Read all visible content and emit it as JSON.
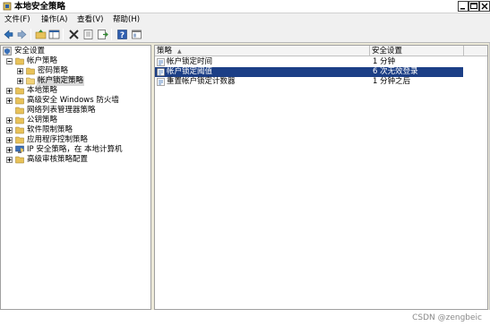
{
  "window": {
    "title": "本地安全策略"
  },
  "menu": [
    {
      "label": "文件(F)"
    },
    {
      "label": "操作(A)"
    },
    {
      "label": "查看(V)"
    },
    {
      "label": "帮助(H)"
    }
  ],
  "toolbar": {
    "buttons": [
      "back-icon",
      "forward-icon",
      "up-folder-icon",
      "show-hide-tree-icon",
      "delete-icon",
      "properties-icon",
      "export-list-icon",
      "help-icon",
      "console-icon"
    ]
  },
  "tree": {
    "root": "安全设置",
    "items": [
      {
        "label": "帐户策略"
      },
      {
        "label": "密码策略"
      },
      {
        "label": "帐户锁定策略"
      },
      {
        "label": "本地策略"
      },
      {
        "label": "高级安全 Windows 防火墙"
      },
      {
        "label": "网络列表管理器策略"
      },
      {
        "label": "公钥策略"
      },
      {
        "label": "软件限制策略"
      },
      {
        "label": "应用程序控制策略"
      },
      {
        "label": "IP 安全策略，在 本地计算机"
      },
      {
        "label": "高级审核策略配置"
      }
    ]
  },
  "list": {
    "columns": [
      "策略",
      "安全设置"
    ],
    "sort_indicator": "▲",
    "rows": [
      {
        "name": "帐户锁定时间",
        "value": "1 分钟"
      },
      {
        "name": "帐户锁定阈值",
        "value": "6 次无效登录"
      },
      {
        "name": "重置帐户锁定计数器",
        "value": "1 分钟之后"
      }
    ],
    "selected_row": 1
  },
  "colors": {
    "selection": "#1c3f86",
    "folder": "#e8c25a"
  },
  "watermark": "CSDN @zengbeic"
}
